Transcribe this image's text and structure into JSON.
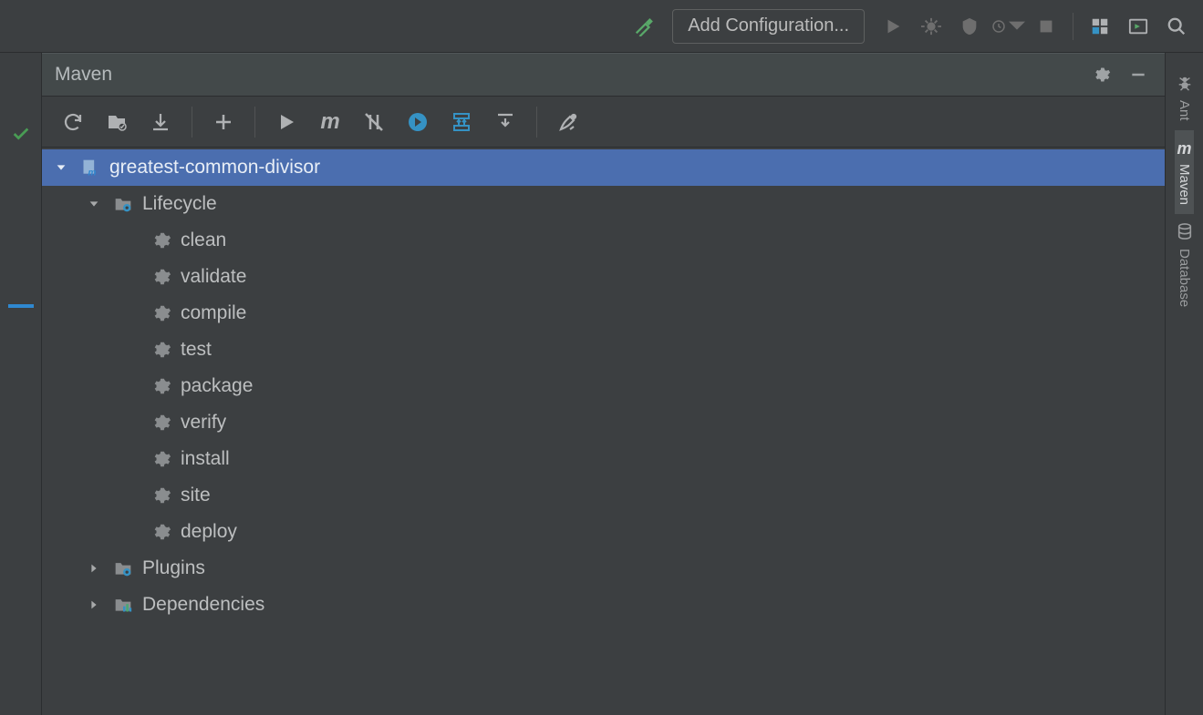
{
  "top_toolbar": {
    "add_config_label": "Add Configuration..."
  },
  "panel": {
    "title": "Maven"
  },
  "tree": {
    "project": "greatest-common-divisor",
    "lifecycle_label": "Lifecycle",
    "plugins_label": "Plugins",
    "dependencies_label": "Dependencies",
    "goals": [
      "clean",
      "validate",
      "compile",
      "test",
      "package",
      "verify",
      "install",
      "site",
      "deploy"
    ]
  },
  "right_tabs": {
    "ant": "Ant",
    "maven": "Maven",
    "database": "Database"
  }
}
